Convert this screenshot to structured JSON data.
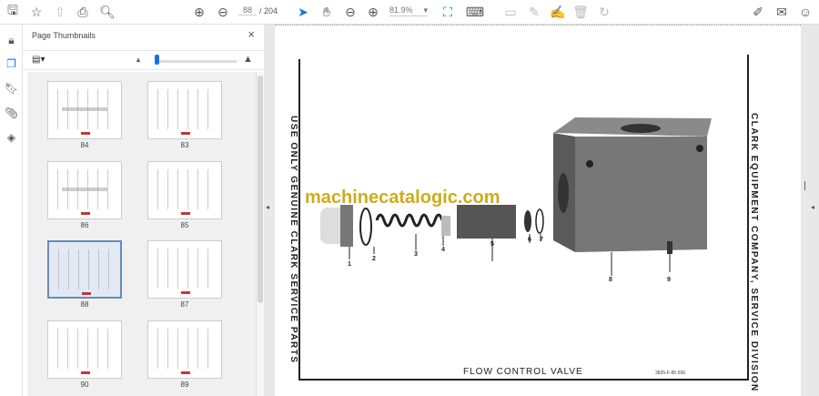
{
  "toolbar": {
    "page_current": "88",
    "page_total": "/ 204",
    "zoom": "81.9%",
    "icons": [
      "save-icon",
      "bookmark-star-icon",
      "upload-icon",
      "print-icon",
      "search-icon",
      "page-up-icon",
      "page-down-icon",
      "select-cursor-icon",
      "hand-icon",
      "zoom-out-icon",
      "zoom-in-icon",
      "fit-page-icon",
      "scroll-mode-icon",
      "comment-icon",
      "highlight-icon",
      "sign-icon",
      "delete-icon",
      "rotate-icon",
      "fill-sign-icon",
      "email-icon",
      "account-icon"
    ]
  },
  "panel": {
    "title": "Page Thumbnails",
    "close": "×"
  },
  "thumbnails": [
    {
      "label": "84"
    },
    {
      "label": "83"
    },
    {
      "label": "86"
    },
    {
      "label": "85"
    },
    {
      "label": "88",
      "selected": true
    },
    {
      "label": "87"
    },
    {
      "label": "90"
    },
    {
      "label": "89"
    }
  ],
  "document": {
    "left_text": "USE ONLY GENUINE CLARK SERVICE PARTS",
    "right_text": "CLARK EQUIPMENT COMPANY, SERVICE DIVISION",
    "caption": "FLOW CONTROL VALVE",
    "code": "3835-F-85-55E",
    "watermark": "machinecatalogic.com",
    "part_numbers": [
      "1",
      "2",
      "3",
      "4",
      "5",
      "6",
      "7",
      "8",
      "9"
    ]
  }
}
